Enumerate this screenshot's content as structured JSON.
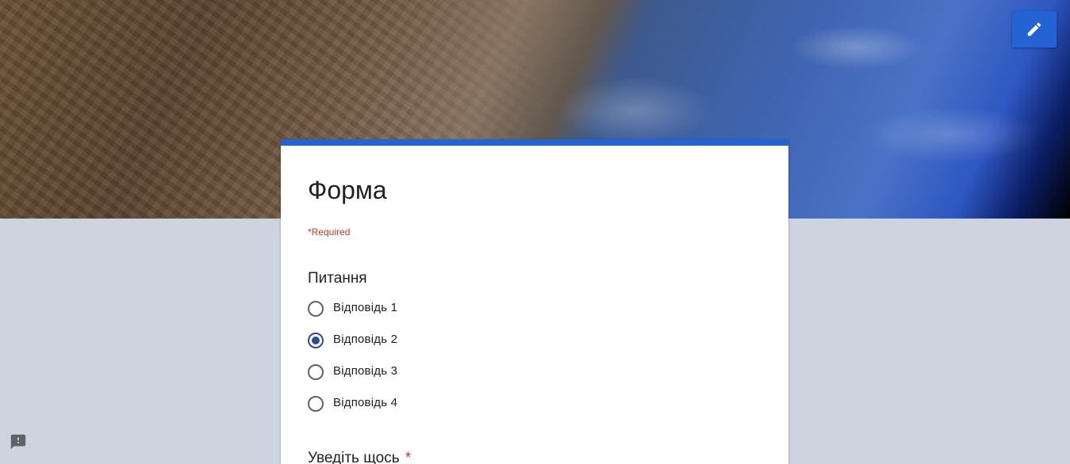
{
  "form": {
    "title": "Форма",
    "required_note": "*Required",
    "question1": {
      "title": "Питання",
      "options": [
        "Відповідь 1",
        "Відповідь 2",
        "Відповідь 3",
        "Відповідь 4"
      ],
      "selected_index": 1
    },
    "question2": {
      "title": "Уведіть щось",
      "required_mark": "*"
    }
  },
  "icons": {
    "edit": "pencil-icon",
    "report": "feedback-icon"
  },
  "colors": {
    "accent": "#2463d4",
    "background": "#cdd3df",
    "required": "#d93025",
    "radio_selected": "#2b4c99"
  }
}
